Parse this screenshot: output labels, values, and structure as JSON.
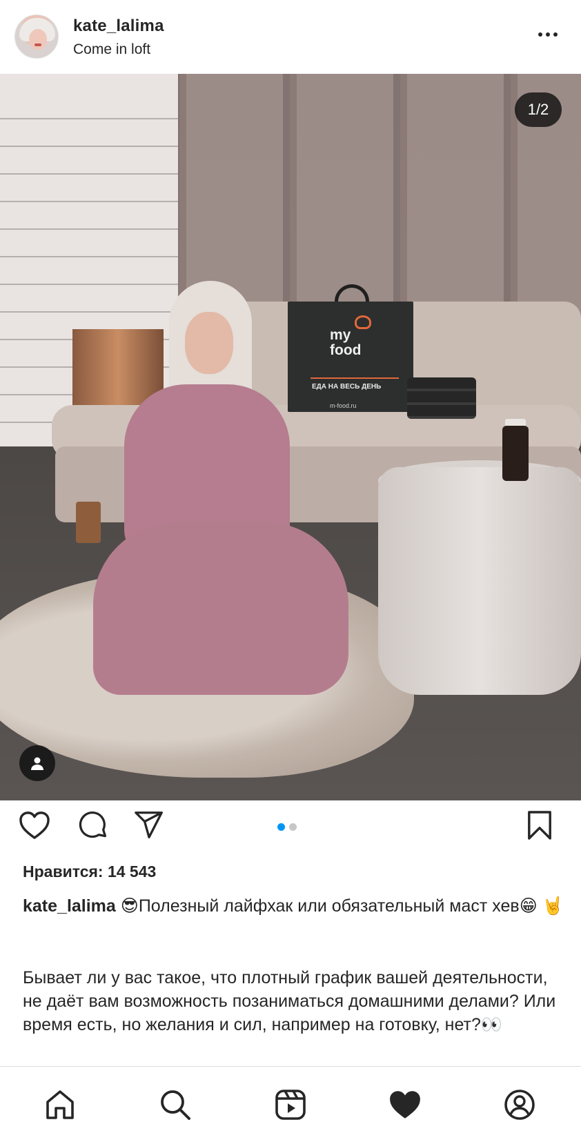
{
  "post": {
    "username": "kate_lalima",
    "location": "Come in loft",
    "more_icon": "more-horizontal-icon"
  },
  "photo": {
    "counter": "1/2",
    "bag_brand": "my\nfood",
    "bag_tagline": "ЕДА НА ВЕСЬ ДЕНЬ",
    "bag_url": "m-food.ru",
    "tag_icon": "user-tag-icon"
  },
  "actions": {
    "like_icon": "heart-outline-icon",
    "comment_icon": "comment-icon",
    "share_icon": "send-icon",
    "save_icon": "bookmark-icon",
    "carousel": {
      "count": 2,
      "active": 0
    },
    "accent_color": "#0095f6"
  },
  "likes": "Нравится: 14 543",
  "caption": {
    "username": "kate_lalima",
    "text": " 😎Полезный лайфхак или обязательный маст хев😁 🤘",
    "body": "Бывает ли у вас такое, что плотный график вашей деятельности, не даёт вам возможность позаниматься домашними делами? Или время есть, но желания и сил, например на готовку, нет?👀"
  },
  "bottom_nav": {
    "items": [
      {
        "name": "home",
        "icon": "home-icon"
      },
      {
        "name": "search",
        "icon": "search-icon"
      },
      {
        "name": "reels",
        "icon": "reels-icon"
      },
      {
        "name": "activity",
        "icon": "heart-filled-icon"
      },
      {
        "name": "profile",
        "icon": "profile-icon"
      }
    ]
  }
}
